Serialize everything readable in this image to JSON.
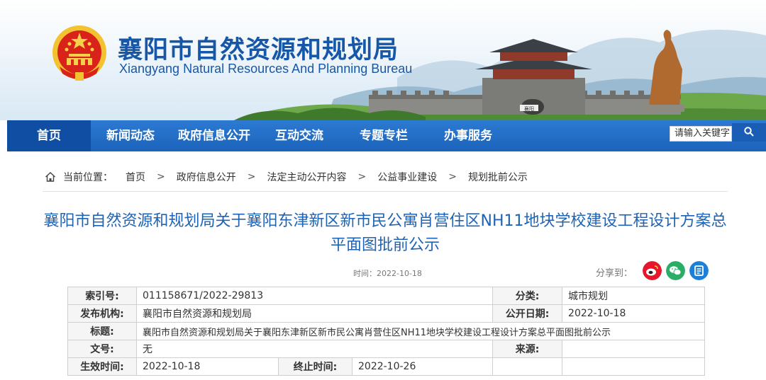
{
  "header": {
    "title": "襄阳市自然资源和规划局",
    "subtitle": "Xiangyang Natural Resources And Planning Bureau",
    "gate_sign": "襄阳"
  },
  "nav": {
    "items": [
      {
        "label": "首页",
        "active": true
      },
      {
        "label": "新闻动态"
      },
      {
        "label": "政府信息公开"
      },
      {
        "label": "互动交流"
      },
      {
        "label": "专题专栏"
      },
      {
        "label": "办事服务"
      }
    ],
    "search_placeholder": "请输入关键字",
    "search_icon": "search-icon"
  },
  "breadcrumb": {
    "prefix": "当前位置：",
    "items": [
      "首页",
      "政府信息公开",
      "法定主动公开内容",
      "公益事业建设",
      "规划批前公示"
    ],
    "separator": ">"
  },
  "article": {
    "title": "襄阳市自然资源和规划局关于襄阳东津新区新市民公寓肖营住区NH11地块学校建设工程设计方案总平面图批前公示",
    "time_label": "时间：",
    "time": "2022-10-18",
    "share_label": "分享到：",
    "share_icons": [
      "weibo-icon",
      "wechat-icon",
      "qzone-icon"
    ]
  },
  "meta": {
    "index_no_label": "索引号:",
    "index_no": "011158671/2022-29813",
    "category_label": "分类:",
    "category": "城市规划",
    "publisher_label": "发布机构:",
    "publisher": "襄阳市自然资源和规划局",
    "pub_date_label": "公开日期:",
    "pub_date": "2022-10-18",
    "subject_label": "标题:",
    "subject": "襄阳市自然资源和规划局关于襄阳东津新区新市民公寓肖营住区NH11地块学校建设工程设计方案总平面图批前公示",
    "doc_no_label": "文号:",
    "doc_no": "无",
    "source_label": "来源:",
    "source": "",
    "effective_label": "生效时间:",
    "effective": "2022-10-18",
    "expire_label": "终止时间:",
    "expire": "2022-10-26"
  },
  "colors": {
    "brand_blue": "#1757a8",
    "nav_blue": "#1c63bb",
    "title_blue": "#1f63b4",
    "weibo_red": "#e6162d",
    "wechat_green": "#2aae67",
    "qzone_blue": "#1e7fd8"
  }
}
